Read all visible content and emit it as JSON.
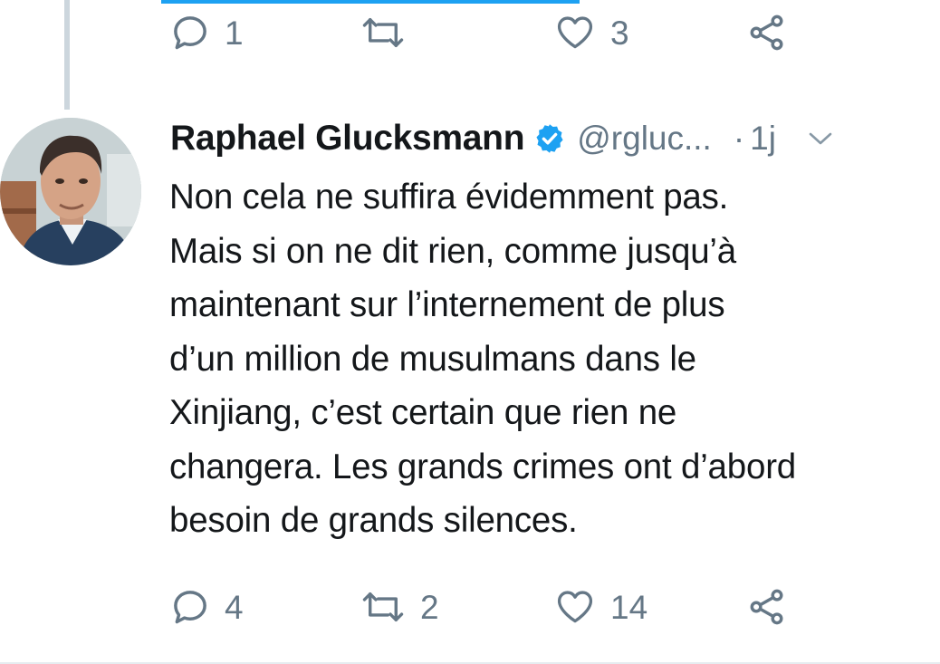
{
  "top_actions": {
    "reply_count": "1",
    "retweet_count": "",
    "like_count": "3"
  },
  "tweet": {
    "author_name": "Raphael Glucksmann",
    "handle": "@rgluc...",
    "separator": "·",
    "time": "1j",
    "text": "Non cela ne suffira évidemment pas.\nMais si on ne dit rien, comme jusqu’à\nmaintenant sur l’internement de plus\nd’un million de musulmans dans le\nXinjiang, c’est certain que rien ne\nchangera. Les grands crimes ont d’abord\nbesoin de grands silences.",
    "reply_count": "4",
    "retweet_count": "2",
    "like_count": "14"
  },
  "icons": {
    "reply": "reply-icon",
    "retweet": "retweet-icon",
    "like": "heart-icon",
    "share": "share-icon",
    "verified": "verified-badge-icon",
    "menu": "chevron-down-icon"
  },
  "colors": {
    "accent": "#1da1f2",
    "muted": "#657786",
    "text": "#14171a",
    "thread_line": "#ccd6dd"
  }
}
